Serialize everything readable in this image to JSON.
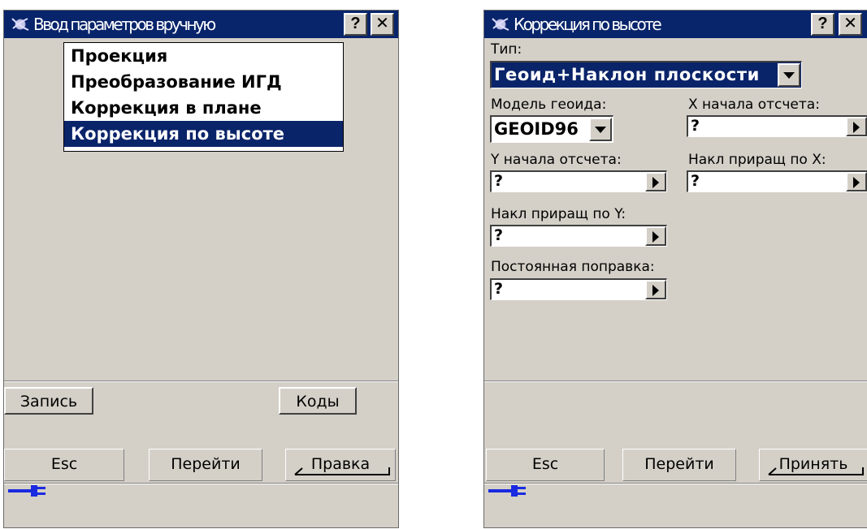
{
  "left_window": {
    "title": "Ввод параметров вручную",
    "help_label": "?",
    "close_label": "✕",
    "menu": [
      {
        "label": "Проекция",
        "selected": false
      },
      {
        "label": "Преобразование ИГД",
        "selected": false
      },
      {
        "label": "Коррекция в плане",
        "selected": false
      },
      {
        "label": "Коррекция по высоте",
        "selected": true
      }
    ],
    "record_button": "Запись",
    "codes_button": "Коды",
    "esc_button": "Esc",
    "goto_button": "Перейти",
    "edit_button": "Правка"
  },
  "right_window": {
    "title": "Коррекция по высоте",
    "help_label": "?",
    "close_label": "✕",
    "type_label": "Тип:",
    "type_value": "Геоид+Наклон плоскости",
    "geoid_label": "Модель геоида:",
    "geoid_value": "GEOID96",
    "x_origin_label": "X начала отсчета:",
    "x_origin_value": "?",
    "y_origin_label": "Y начала отсчета:",
    "y_origin_value": "?",
    "x_slope_label": "Накл приращ по X:",
    "x_slope_value": "?",
    "y_slope_label": "Накл приращ по Y:",
    "y_slope_value": "?",
    "const_label": "Постоянная поправка:",
    "const_value": "?",
    "esc_button": "Esc",
    "goto_button": "Перейти",
    "accept_button": "Принять"
  },
  "colors": {
    "titlebar": "#08246b",
    "selection": "#0a246a",
    "dialog_bg": "#d4d0c8",
    "plug": "#1a2ae0"
  },
  "icons": [
    "app-icon",
    "help-icon",
    "close-icon",
    "dropdown-arrow-icon",
    "right-arrow-icon",
    "power-plug-icon"
  ]
}
